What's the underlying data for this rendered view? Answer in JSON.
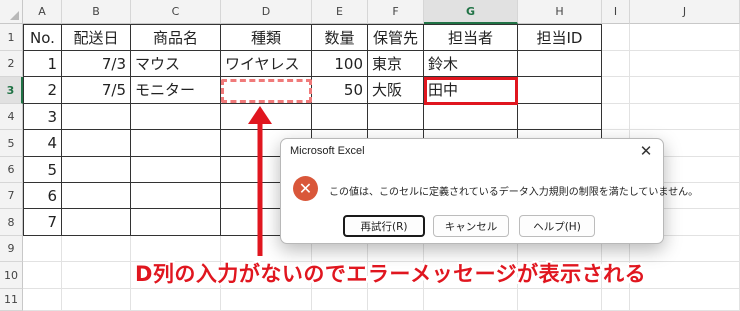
{
  "columns": [
    "A",
    "B",
    "C",
    "D",
    "E",
    "F",
    "G",
    "H",
    "I",
    "J"
  ],
  "selected_column": "G",
  "rows": [
    "1",
    "2",
    "3",
    "4",
    "5",
    "6",
    "7",
    "8",
    "9",
    "10",
    "11"
  ],
  "selected_row": "3",
  "table": {
    "headers": [
      "No.",
      "配送日",
      "商品名",
      "種類",
      "数量",
      "保管先",
      "担当者",
      "担当ID"
    ],
    "data": [
      [
        "1",
        "7/3",
        "マウス",
        "ワイヤレス",
        "100",
        "東京",
        "鈴木",
        ""
      ],
      [
        "2",
        "7/5",
        "モニター",
        "",
        "50",
        "大阪",
        "田中",
        ""
      ],
      [
        "3",
        "",
        "",
        "",
        "",
        "",
        "",
        ""
      ],
      [
        "4",
        "",
        "",
        "",
        "",
        "",
        "",
        ""
      ],
      [
        "5",
        "",
        "",
        "",
        "",
        "",
        "",
        ""
      ],
      [
        "6",
        "",
        "",
        "",
        "",
        "",
        "",
        ""
      ],
      [
        "7",
        "",
        "",
        "",
        "",
        "",
        "",
        ""
      ]
    ]
  },
  "dialog": {
    "title": "Microsoft Excel",
    "close_glyph": "✕",
    "icon_glyph": "✕",
    "message": "この値は、このセルに定義されているデータ入力規則の制限を満たしていません。",
    "buttons": [
      "再試行(R)",
      "キャンセル",
      "ヘルプ(H)"
    ]
  },
  "annotation": {
    "caption": "D列の入力がないのでエラーメッセージが表示される",
    "color": "#e0161f"
  }
}
